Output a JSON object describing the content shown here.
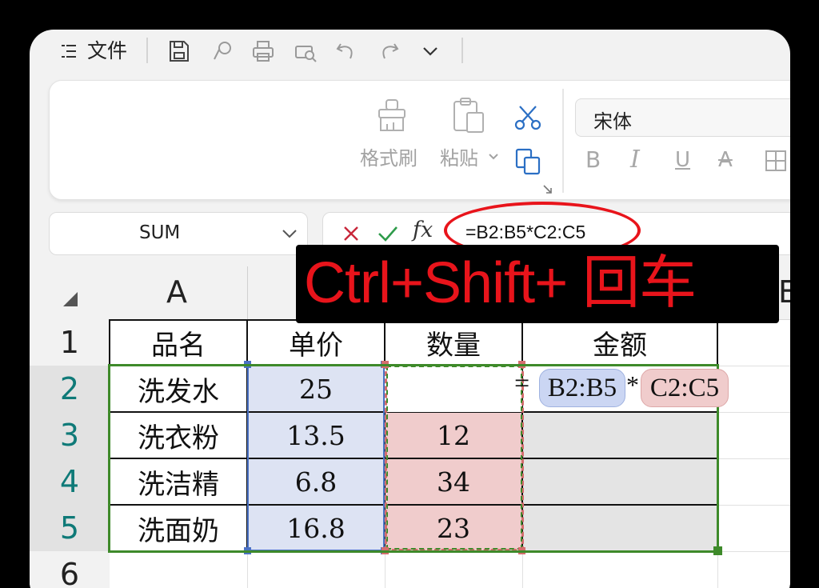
{
  "menu": {
    "label": "文件"
  },
  "ribbon": {
    "format_painter": "格式刷",
    "paste": "粘贴",
    "font_name": "宋体",
    "bold": "B",
    "italic": "I",
    "underline": "U",
    "strike": "A"
  },
  "namebox": {
    "value": "SUM"
  },
  "formula": {
    "fx": "fx",
    "text": "=B2:B5*C2:C5"
  },
  "overlay": {
    "text": "Ctrl+Shift+ 回车"
  },
  "columns": [
    "A",
    "E"
  ],
  "rows": [
    "1",
    "2",
    "3",
    "4",
    "5",
    "6"
  ],
  "headers": [
    "品名",
    "单价",
    "数量",
    "金额"
  ],
  "names": [
    "洗发水",
    "洗衣粉",
    "洗洁精",
    "洗面奶"
  ],
  "prices": [
    "25",
    "13.5",
    "6.8",
    "16.8"
  ],
  "quantities": [
    "12",
    "34",
    "23"
  ],
  "editing_formula": {
    "eq": "=",
    "ref1": "B2:B5",
    "op": "*",
    "ref2": "C2:C5"
  },
  "colors": {
    "accent_red": "#e8141b",
    "price_fill": "#dde3f3",
    "qty_fill": "#f0cccc",
    "selection_green": "#3e8a2a"
  }
}
